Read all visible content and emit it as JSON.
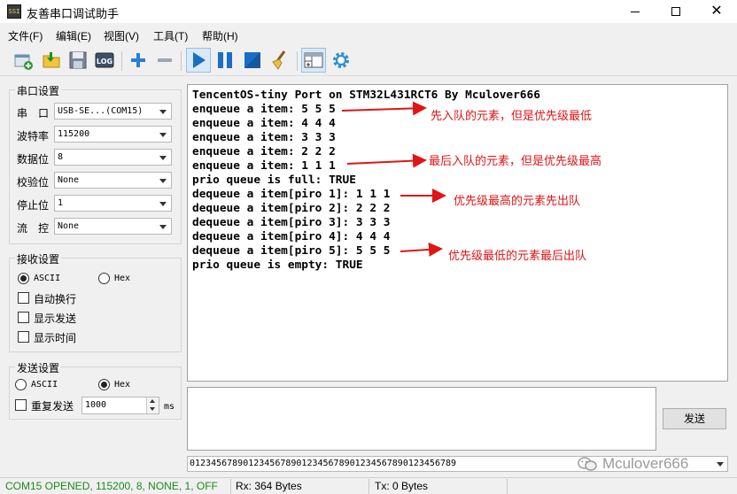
{
  "window": {
    "title": "友善串口调试助手",
    "icon_text": "SSI"
  },
  "menu": [
    "文件(F)",
    "编辑(E)",
    "视图(V)",
    "工具(T)",
    "帮助(H)"
  ],
  "toolbar": {
    "log_label": "LOG",
    "icons": [
      "new-window-icon",
      "open-folder-icon",
      "save-icon",
      "log-icon",
      "add-icon",
      "remove-icon",
      "play-icon",
      "pause-icon",
      "stop-icon",
      "clear-broom-icon",
      "extend-view-icon",
      "settings-gear-icon"
    ]
  },
  "serial_settings": {
    "title": "串口设置",
    "rows": [
      {
        "label": "串　口",
        "value": "USB-SE...(COM15)"
      },
      {
        "label": "波特率",
        "value": "115200"
      },
      {
        "label": "数据位",
        "value": "8"
      },
      {
        "label": "校验位",
        "value": "None"
      },
      {
        "label": "停止位",
        "value": "1"
      },
      {
        "label": "流　控",
        "value": "None"
      }
    ]
  },
  "receive_settings": {
    "title": "接收设置",
    "ascii_label": "ASCII",
    "hex_label": "Hex",
    "ascii_selected": true,
    "auto_wrap_label": "自动换行",
    "show_send_label": "显示发送",
    "show_time_label": "显示时间"
  },
  "send_settings": {
    "title": "发送设置",
    "ascii_label": "ASCII",
    "hex_label": "Hex",
    "hex_selected": true,
    "repeat_label": "重复发送",
    "interval_value": "1000",
    "interval_unit": "ms"
  },
  "receive_lines": [
    "TencentOS-tiny Port on STM32L431RCT6 By Mculover666",
    "enqueue a item: 5 5 5",
    "enqueue a item: 4 4 4",
    "enqueue a item: 3 3 3",
    "enqueue a item: 2 2 2",
    "enqueue a item: 1 1 1",
    "prio queue is full: TRUE",
    "dequeue a item[piro 1]: 1 1 1",
    "dequeue a item[piro 2]: 2 2 2",
    "dequeue a item[piro 3]: 3 3 3",
    "dequeue a item[piro 4]: 4 4 4",
    "dequeue a item[piro 5]: 5 5 5",
    "prio queue is empty: TRUE"
  ],
  "annotations": [
    "先入队的元素，但是优先级最低",
    "最后入队的元素，但是优先级最高",
    "优先级最高的元素先出队",
    "优先级最低的元素最后出队"
  ],
  "annotation_color": "#e01515",
  "send_button_label": "发送",
  "history_text": "01234567890123456789012345678901234567890123456789",
  "watermark_text": "Mculover666",
  "status": {
    "port": "COM15 OPENED, 115200, 8, NONE, 1, OFF",
    "rx": "Rx: 364 Bytes",
    "tx": "Tx: 0 Bytes",
    "port_color": "#1a8a1a"
  }
}
